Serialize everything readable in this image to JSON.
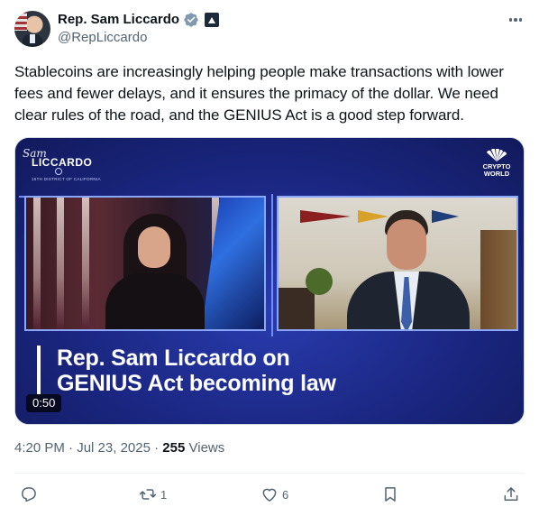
{
  "author": {
    "display_name": "Rep. Sam Liccardo",
    "handle": "@RepLiccardo",
    "verified_color": "#829aab",
    "affiliation_badge": "government-affiliation-icon"
  },
  "tweet": {
    "text": "Stablecoins are increasingly helping people make transactions with lower fees and fewer delays, and it ensures the primacy of the dollar. We need clear rules of the road, and the GENIUS Act is a good step forward.",
    "time": "4:20 PM",
    "date": "Jul 23, 2025",
    "views_count": "255",
    "views_label": "Views"
  },
  "video": {
    "duration": "0:50",
    "brand_signature": "Sam",
    "brand_name": "LICCARDO",
    "brand_subtitle": "16TH DISTRICT OF CALIFORNIA",
    "network_line1": "CRYPTO",
    "network_line2": "WORLD",
    "headline_line1": "Rep. Sam Liccardo on",
    "headline_line2": "GENIUS Act becoming law",
    "background_color": "#1b2a7e"
  },
  "actions": {
    "reply_count": "",
    "retweet_count": "1",
    "like_count": "6"
  },
  "colors": {
    "text_primary": "#0f1419",
    "text_secondary": "#536471",
    "divider": "#eff3f4"
  }
}
